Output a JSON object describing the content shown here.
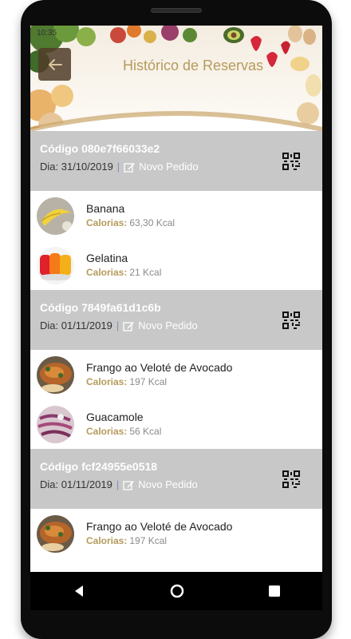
{
  "status_bar": {
    "time": "10:35"
  },
  "header": {
    "title": "Histórico de Reservas"
  },
  "orders": [
    {
      "code": "Código 080e7f66033e2",
      "date": "Dia: 31/10/2019",
      "separator": "|",
      "status": "Novo Pedido",
      "items": [
        {
          "name": "Banana",
          "cal_label": "Calorias:",
          "cal_value": "63,30 Kcal"
        },
        {
          "name": "Gelatina",
          "cal_label": "Calorias:",
          "cal_value": "21 Kcal"
        }
      ]
    },
    {
      "code": "Código 7849fa61d1c6b",
      "date": "Dia: 01/11/2019",
      "separator": "|",
      "status": "Novo Pedido",
      "items": [
        {
          "name": "Frango ao Veloté de Avocado",
          "cal_label": "Calorias:",
          "cal_value": "197 Kcal"
        },
        {
          "name": "Guacamole",
          "cal_label": "Calorias:",
          "cal_value": "56 Kcal"
        }
      ]
    },
    {
      "code": "Código fcf24955e0518",
      "date": "Dia: 01/11/2019",
      "separator": "|",
      "status": "Novo Pedido",
      "items": [
        {
          "name": "Frango ao Veloté de Avocado",
          "cal_label": "Calorias:",
          "cal_value": "197 Kcal"
        }
      ]
    }
  ],
  "icons": {
    "back": "arrow-left-icon",
    "edit": "edit-icon",
    "qr": "qr-code-icon",
    "nav_back": "nav-back-icon",
    "nav_home": "nav-home-icon",
    "nav_recent": "nav-recent-icon"
  },
  "colors": {
    "accent": "#b59b5b",
    "order_header_bg": "#c8c8c8",
    "frame": "#0c0c0c"
  }
}
